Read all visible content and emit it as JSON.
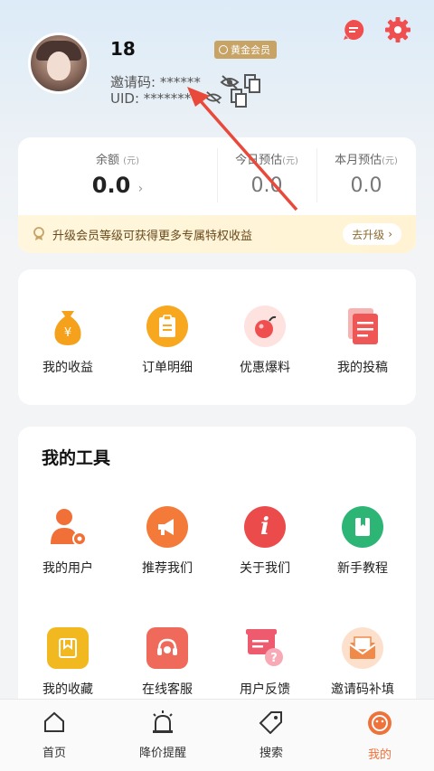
{
  "profile": {
    "username": "18",
    "vip_label": "黄金会员",
    "invite_label": "邀请码: ******",
    "uid_label": "UID: *******"
  },
  "balance": {
    "balance_label": "余额",
    "unit": "(元)",
    "balance_value": "0.0",
    "today_label": "今日预估",
    "today_value": "0.0",
    "month_label": "本月预估",
    "month_value": "0.0",
    "upgrade_text": "升级会员等级可获得更多专属特权收益",
    "upgrade_button": "去升级"
  },
  "quick_actions": [
    {
      "label": "我的收益",
      "icon": "money-bag-icon",
      "color": "#f6a11b"
    },
    {
      "label": "订单明细",
      "icon": "clipboard-icon",
      "color": "#f7a81e"
    },
    {
      "label": "优惠爆料",
      "icon": "bomb-icon",
      "color": "#ef4f4f"
    },
    {
      "label": "我的投稿",
      "icon": "document-icon",
      "color": "#ef5656"
    }
  ],
  "tools": {
    "title": "我的工具",
    "items": [
      {
        "label": "我的用户",
        "icon": "user-gear-icon",
        "color": "#f07038"
      },
      {
        "label": "推荐我们",
        "icon": "megaphone-icon",
        "color": "#f47a3a"
      },
      {
        "label": "关于我们",
        "icon": "info-icon",
        "color": "#ec4b4b"
      },
      {
        "label": "新手教程",
        "icon": "book-icon",
        "color": "#2cb574"
      },
      {
        "label": "我的收藏",
        "icon": "bookmark-icon",
        "color": "#f2b820"
      },
      {
        "label": "在线客服",
        "icon": "headset-icon",
        "color": "#ef6a5a"
      },
      {
        "label": "用户反馈",
        "icon": "feedback-icon",
        "color": "#ee5a6e"
      },
      {
        "label": "邀请码补填",
        "icon": "envelope-icon",
        "color": "#f08a4a"
      }
    ]
  },
  "tabbar": [
    {
      "label": "首页",
      "icon": "home-icon",
      "active": false
    },
    {
      "label": "降价提醒",
      "icon": "alarm-icon",
      "active": false
    },
    {
      "label": "搜索",
      "icon": "tag-icon",
      "active": false
    },
    {
      "label": "我的",
      "icon": "profile-face-icon",
      "active": true
    }
  ],
  "colors": {
    "accent": "#f0723b",
    "gold": "#c7a366",
    "arrow": "#e8493a"
  }
}
